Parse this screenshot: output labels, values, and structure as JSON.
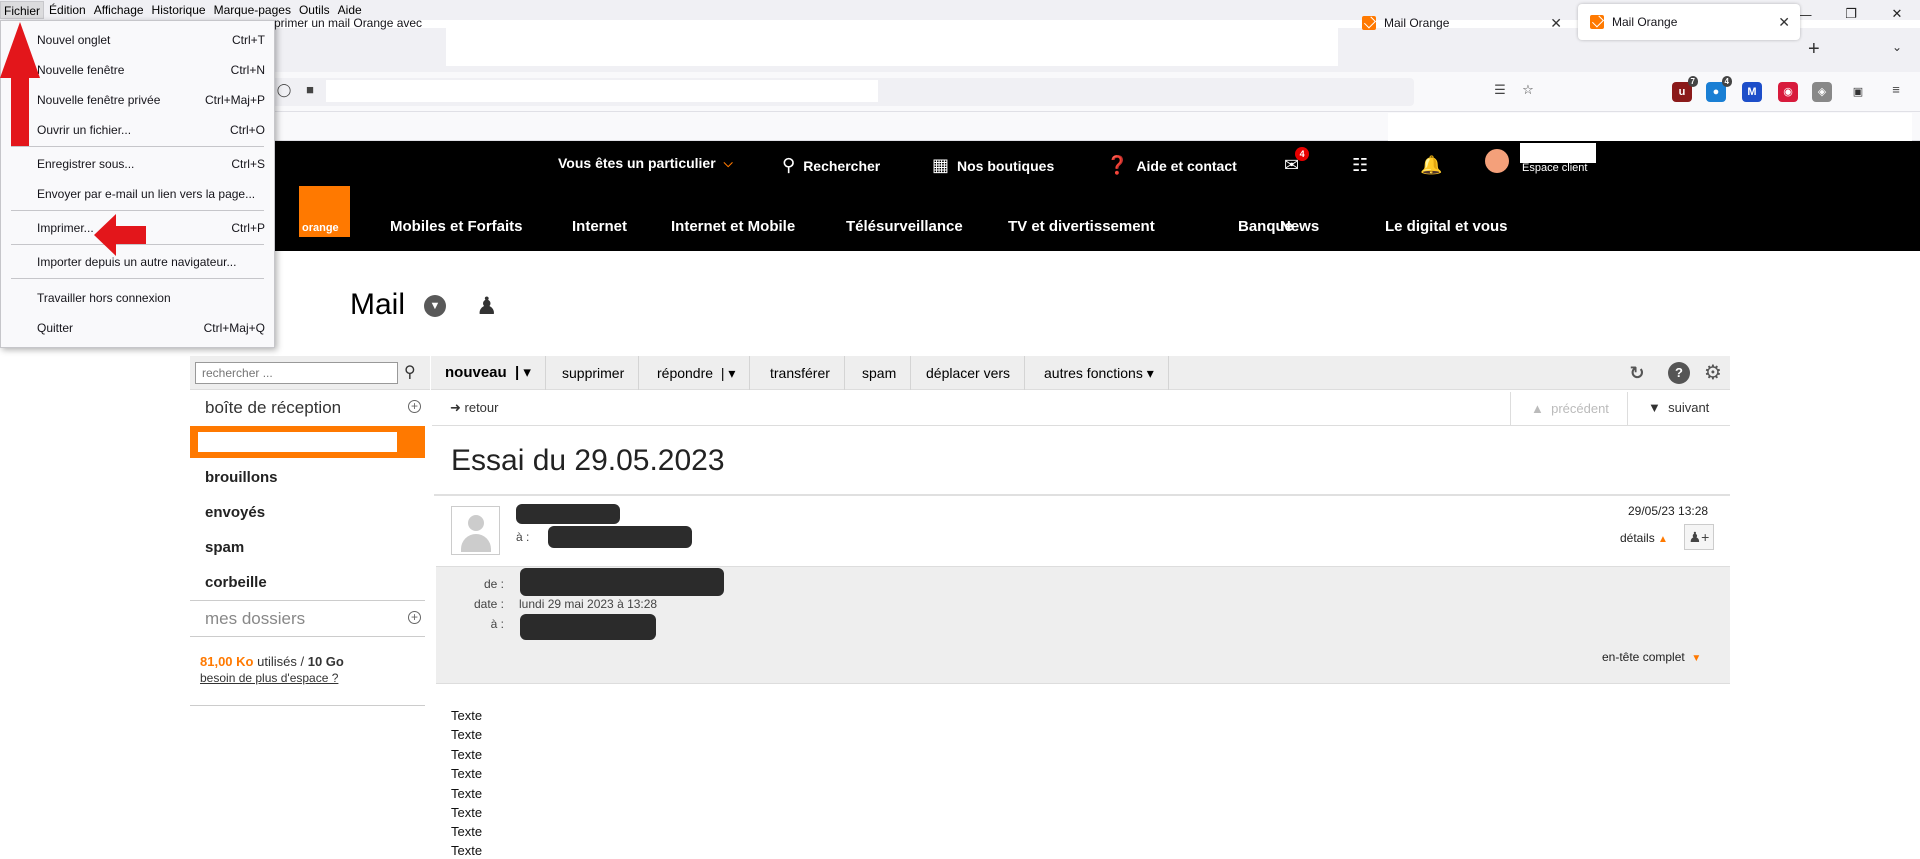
{
  "menubar": {
    "items": [
      "Fichier",
      "Édition",
      "Affichage",
      "Historique",
      "Marque-pages",
      "Outils",
      "Aide"
    ]
  },
  "tabs": [
    {
      "label": "primer un mail Orange avec"
    },
    {
      "label": "Mail Orange"
    },
    {
      "label": "Mail Orange"
    }
  ],
  "extensions": [
    {
      "badge": "7",
      "color": "#8b1a1a"
    },
    {
      "badge": "4",
      "color": "#1a7fd4"
    },
    {
      "badge": "",
      "color": "#1d4ec9"
    },
    {
      "badge": "",
      "color": "#d81b3c"
    },
    {
      "badge": "",
      "color": "#888888"
    },
    {
      "badge": "",
      "color": "#555555"
    }
  ],
  "orange": {
    "top": {
      "particulier": "Vous êtes un particulier",
      "rechercher": "Rechercher",
      "boutiques": "Nos boutiques",
      "aide": "Aide et contact",
      "mail_badge": "4",
      "espace": "Espace client"
    },
    "logo": "orange",
    "nav": [
      "Mobiles et Forfaits",
      "Internet",
      "Internet et Mobile",
      "Télésurveillance",
      "TV et divertissement",
      "Banque",
      "News",
      "Le digital et vous"
    ],
    "brand_color": "#ff7900"
  },
  "mail": {
    "title": "Mail",
    "search_placeholder": "rechercher ...",
    "toolbar": {
      "nouveau": "nouveau",
      "supprimer": "supprimer",
      "repondre": "répondre",
      "transferer": "transférer",
      "spam": "spam",
      "deplacer": "déplacer vers",
      "autres": "autres fonctions"
    },
    "sidebar": {
      "inbox": "boîte de réception",
      "items": [
        "brouillons",
        "envoyés",
        "spam",
        "corbeille"
      ],
      "folders": "mes dossiers",
      "quota_used": "81,00",
      "quota_unit": "Ko",
      "quota_text": "utilisés /",
      "quota_total": "10 Go",
      "more_space": "besoin de plus d'espace ?"
    },
    "message": {
      "retour": "retour",
      "precedent": "précédent",
      "suivant": "suivant",
      "subject": "Essai du 29.05.2023",
      "to_label": "à :",
      "date_short": "29/05/23 13:28",
      "details": "détails",
      "hdr_de": "de :",
      "hdr_date": "date :",
      "hdr_a": "à :",
      "hdr_date_val": "lundi 29 mai 2023 à 13:28",
      "full_header": "en-tête complet",
      "body_lines": [
        "Texte",
        "Texte",
        "Texte",
        "Texte",
        "Texte",
        "Texte",
        "Texte",
        "Texte"
      ]
    }
  },
  "dropdown": {
    "items": [
      {
        "label": "Nouvel onglet",
        "shortcut": "Ctrl+T"
      },
      {
        "label": "Nouvelle fenêtre",
        "shortcut": "Ctrl+N"
      },
      {
        "label": "Nouvelle fenêtre privée",
        "shortcut": "Ctrl+Maj+P"
      },
      {
        "label": "Ouvrir un fichier...",
        "shortcut": "Ctrl+O"
      },
      {
        "label": "Enregistrer sous...",
        "shortcut": "Ctrl+S"
      },
      {
        "label": "Envoyer par e-mail un lien vers la page...",
        "shortcut": ""
      },
      {
        "label": "Imprimer...",
        "shortcut": "Ctrl+P"
      },
      {
        "label": "Importer depuis un autre navigateur...",
        "shortcut": ""
      },
      {
        "label": "Travailler hors connexion",
        "shortcut": ""
      },
      {
        "label": "Quitter",
        "shortcut": "Ctrl+Maj+Q"
      }
    ]
  },
  "annotation_color": "#e3161b"
}
